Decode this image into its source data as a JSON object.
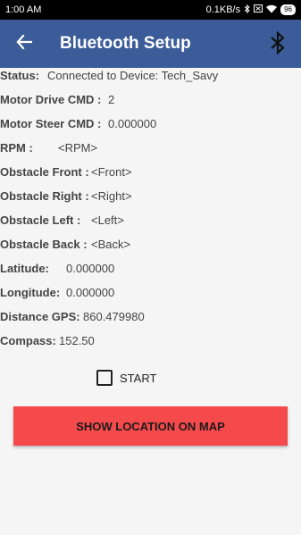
{
  "status_bar": {
    "time": "1:00 AM",
    "net_speed": "0.1KB/s",
    "battery": "96"
  },
  "toolbar": {
    "title": "Bluetooth Setup"
  },
  "fields": [
    {
      "label": "Status:",
      "value": "Connected to Device: Tech_Savy"
    },
    {
      "label": "Motor Drive CMD :",
      "value": "2"
    },
    {
      "label": "Motor Steer CMD :",
      "value": "0.000000"
    },
    {
      "label": "RPM :",
      "value": "<RPM>"
    },
    {
      "label": "Obstacle Front :",
      "value": "<Front>"
    },
    {
      "label": "Obstacle Right :",
      "value": "<Right>"
    },
    {
      "label": "Obstacle Left :",
      "value": "<Left>"
    },
    {
      "label": "Obstacle Back :",
      "value": "<Back>"
    },
    {
      "label": "Latitude:",
      "value": "0.000000"
    },
    {
      "label": "Longitude:",
      "value": "0.000000"
    },
    {
      "label": "Distance GPS:",
      "value": "860.479980"
    },
    {
      "label": "Compass:",
      "value": "152.50"
    }
  ],
  "start_checkbox": {
    "label": "START",
    "checked": false
  },
  "map_button": {
    "label": "SHOW LOCATION ON MAP"
  },
  "colors": {
    "toolbar": "#3b5c99",
    "map_button": "#f54a4c"
  }
}
